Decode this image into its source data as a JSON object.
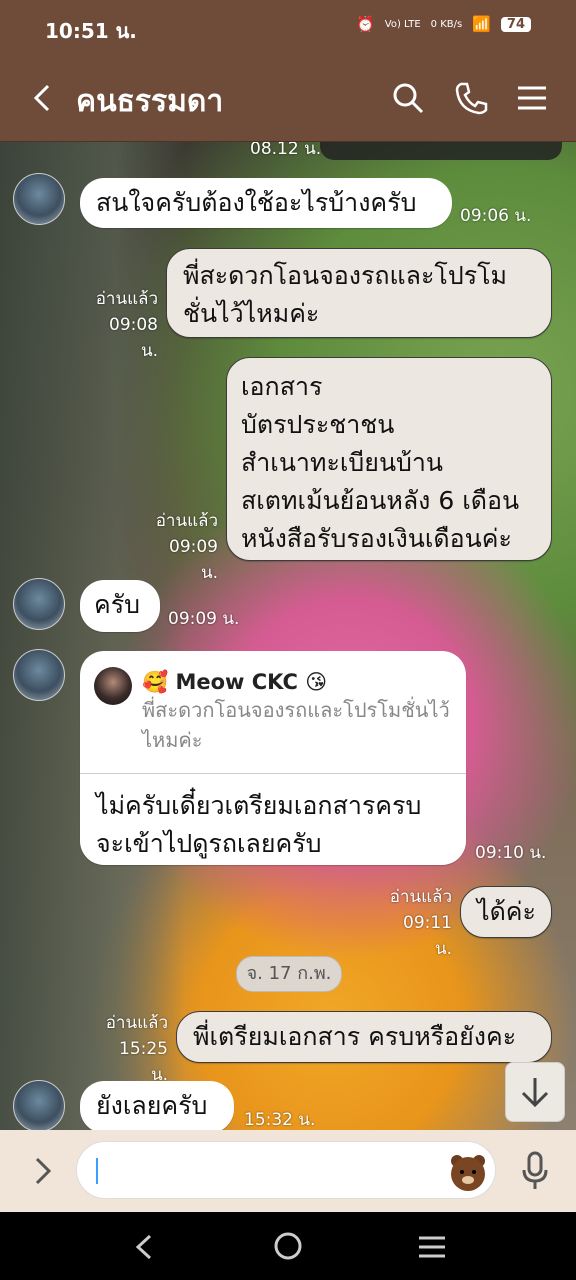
{
  "status": {
    "time": "10:51 น.",
    "net_lte": "Vo) LTE",
    "speed": "0 KB/s",
    "battery": "74"
  },
  "header": {
    "title": "คนธรรมดา"
  },
  "top_partial_time": "08.12 น.",
  "messages": [
    {
      "dir": "in",
      "text": "สนใจครับต้องใช้อะไรบ้างครับ",
      "time": "09:06 น."
    },
    {
      "dir": "out",
      "text": "พี่สะดวกโอนจองรถและโปรโม\nชั่นไว้ไหมค่ะ",
      "read": "อ่านแล้ว",
      "time": "09:08 น."
    },
    {
      "dir": "out",
      "text": "เอกสาร\nบัตรประชาชน\nสำเนาทะเบียนบ้าน\nสเตทเม้นย้อนหลัง 6 เดือน\nหนังสือรับรองเงินเดือนค่ะ",
      "read": "อ่านแล้ว",
      "time": "09:09 น."
    },
    {
      "dir": "in",
      "text": "ครับ",
      "time": "09:09 น."
    },
    {
      "dir": "in",
      "reply_name": "🥰 Meow CKC 😘",
      "reply_text": "พี่สะดวกโอนจองรถและโปรโมชั่นไว้ไหมค่ะ",
      "text": "ไม่ครับเดี๋ยวเตรียมเอกสารครบ\nจะเข้าไปดูรถเลยครับ",
      "time": "09:10 น."
    },
    {
      "dir": "out",
      "text": "ได้ค่ะ",
      "read": "อ่านแล้ว",
      "time": "09:11 น."
    },
    {
      "dir": "date",
      "text": "จ. 17 ก.พ."
    },
    {
      "dir": "out",
      "text": "พี่เตรียมเอกสาร ครบหรือยังคะ",
      "read": "อ่านแล้ว",
      "time": "15:25 น."
    },
    {
      "dir": "in",
      "text": "ยังเลยครับ",
      "time": "15:32 น."
    }
  ],
  "composer": {
    "placeholder": ""
  },
  "icons": {
    "back": "back-arrow-icon",
    "search": "search-icon",
    "call": "phone-icon",
    "menu": "hamburger-menu-icon",
    "expand": "chevron-right-icon",
    "sticker": "bear-sticker-icon",
    "mic": "microphone-icon",
    "scroll": "arrow-down-icon"
  },
  "colors": {
    "header": "#6f4b3a",
    "composer": "#f1e4d9",
    "outgoing_bubble": "#ede7e1"
  }
}
